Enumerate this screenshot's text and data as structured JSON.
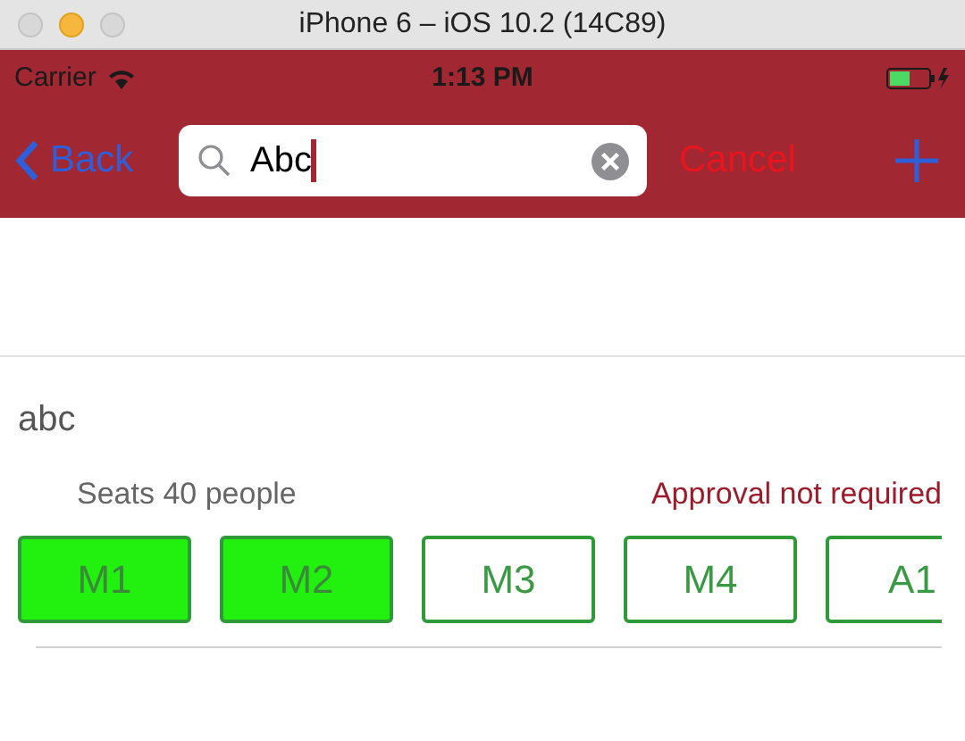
{
  "window": {
    "title": "iPhone 6 – iOS 10.2 (14C89)"
  },
  "status_bar": {
    "carrier": "Carrier",
    "time": "1:13 PM"
  },
  "nav_bar": {
    "back": "Back",
    "search": {
      "value": "Abc"
    },
    "cancel": "Cancel"
  },
  "room": {
    "name": "abc",
    "capacity": "Seats 40 people",
    "approval": "Approval not required",
    "slots": [
      {
        "label": "M1",
        "selected": true
      },
      {
        "label": "M2",
        "selected": true
      },
      {
        "label": "M3",
        "selected": false
      },
      {
        "label": "M4",
        "selected": false
      },
      {
        "label": "A1",
        "selected": false
      }
    ]
  }
}
